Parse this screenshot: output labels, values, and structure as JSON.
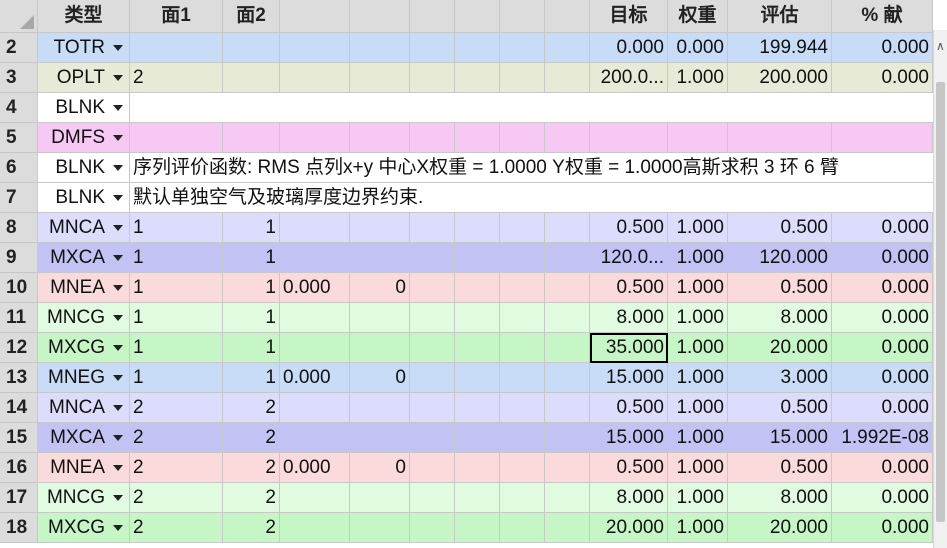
{
  "columns": [
    "",
    "类型",
    "面1",
    "面2",
    "",
    "",
    "",
    "",
    "",
    "",
    "目标",
    "权重",
    "评估",
    "% 献"
  ],
  "row_colors": {
    "TOTR": "#c8dcf8",
    "OPLT": "#e6ead6",
    "BLNK": "#ffffff",
    "DMFS": "#f8c8f4",
    "MNCA": "#dcdcfc",
    "MXCA": "#c2c2f4",
    "MNEA": "#fadada",
    "MNCG": "#e0fbe0",
    "MXCG": "#c6f6c6",
    "MNEG": "#c8dcf8"
  },
  "rows": [
    {
      "num": "2",
      "type": "TOTR",
      "c": [
        "",
        "",
        "",
        "",
        "",
        "",
        "",
        "",
        "0.000",
        "0.000",
        "199.944",
        "0.000"
      ]
    },
    {
      "num": "3",
      "type": "OPLT",
      "c": [
        "2",
        "",
        "",
        "",
        "",
        "",
        "",
        "",
        "200.0...",
        "1.000",
        "200.000",
        "0.000"
      ]
    },
    {
      "num": "4",
      "type": "BLNK",
      "span": ""
    },
    {
      "num": "5",
      "type": "DMFS",
      "c": [
        "",
        "",
        "",
        "",
        "",
        "",
        "",
        "",
        "",
        "",
        "",
        ""
      ]
    },
    {
      "num": "6",
      "type": "BLNK",
      "span": "序列评价函数: RMS 点列x+y 中心X权重 = 1.0000 Y权重 = 1.0000高斯求积 3 环 6 臂"
    },
    {
      "num": "7",
      "type": "BLNK",
      "span": "默认单独空气及玻璃厚度边界约束."
    },
    {
      "num": "8",
      "type": "MNCA",
      "c": [
        "1",
        "1",
        "",
        "",
        "",
        "",
        "",
        "",
        "0.500",
        "1.000",
        "0.500",
        "0.000"
      ]
    },
    {
      "num": "9",
      "type": "MXCA",
      "c": [
        "1",
        "1",
        "",
        "",
        "",
        "",
        "",
        "",
        "120.0...",
        "1.000",
        "120.000",
        "0.000"
      ]
    },
    {
      "num": "10",
      "type": "MNEA",
      "c": [
        "1",
        "1",
        "0.000",
        "0",
        "",
        "",
        "",
        "",
        "0.500",
        "1.000",
        "0.500",
        "0.000"
      ]
    },
    {
      "num": "11",
      "type": "MNCG",
      "c": [
        "1",
        "1",
        "",
        "",
        "",
        "",
        "",
        "",
        "8.000",
        "1.000",
        "8.000",
        "0.000"
      ]
    },
    {
      "num": "12",
      "type": "MXCG",
      "c": [
        "1",
        "1",
        "",
        "",
        "",
        "",
        "",
        "",
        "35.000",
        "1.000",
        "20.000",
        "0.000"
      ],
      "selected": 8
    },
    {
      "num": "13",
      "type": "MNEG",
      "c": [
        "1",
        "1",
        "0.000",
        "0",
        "",
        "",
        "",
        "",
        "15.000",
        "1.000",
        "3.000",
        "0.000"
      ]
    },
    {
      "num": "14",
      "type": "MNCA",
      "c": [
        "2",
        "2",
        "",
        "",
        "",
        "",
        "",
        "",
        "0.500",
        "1.000",
        "0.500",
        "0.000"
      ]
    },
    {
      "num": "15",
      "type": "MXCA",
      "c": [
        "2",
        "2",
        "",
        "",
        "",
        "",
        "",
        "",
        "15.000",
        "1.000",
        "15.000",
        "1.992E-08"
      ]
    },
    {
      "num": "16",
      "type": "MNEA",
      "c": [
        "2",
        "2",
        "0.000",
        "0",
        "",
        "",
        "",
        "",
        "0.500",
        "1.000",
        "0.500",
        "0.000"
      ]
    },
    {
      "num": "17",
      "type": "MNCG",
      "c": [
        "2",
        "2",
        "",
        "",
        "",
        "",
        "",
        "",
        "8.000",
        "1.000",
        "8.000",
        "0.000"
      ]
    },
    {
      "num": "18",
      "type": "MXCG",
      "c": [
        "2",
        "2",
        "",
        "",
        "",
        "",
        "",
        "",
        "20.000",
        "1.000",
        "20.000",
        "0.000"
      ]
    }
  ]
}
